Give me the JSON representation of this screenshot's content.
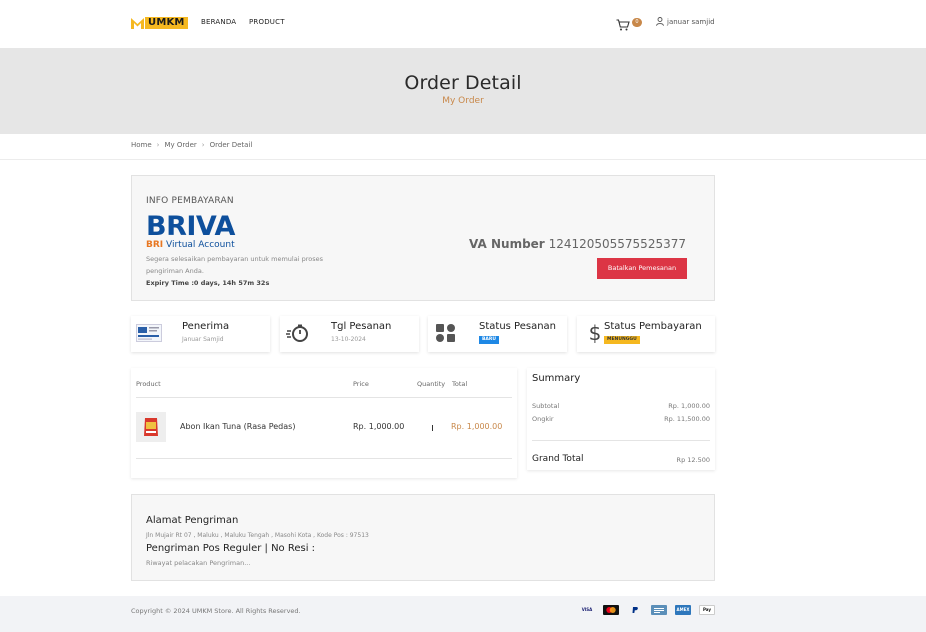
{
  "nav": {
    "logo_text": "UMKM",
    "links": [
      "BERANDA",
      "PRODUCT"
    ],
    "cart_count": "0",
    "user_name": "januar samjid",
    "colors": {
      "accent": "#c8884a",
      "logo_yellow": "#f5b820"
    }
  },
  "hero": {
    "title": "Order Detail",
    "subtitle": "My Order"
  },
  "breadcrumb": [
    "Home",
    "My Order",
    "Order Detail"
  ],
  "payment": {
    "title": "INFO PEMBAYARAN",
    "brand_big": "BRIVA",
    "brand_bri": "BRI",
    "brand_va": "Virtual Account",
    "hint": "Segera selesaikan pembayaran untuk memulai proses pengiriman Anda.",
    "expiry": "Expiry Time :0 days, 14h 57m 32s",
    "va_label": "VA Number",
    "va_value": "124120505575525377",
    "cancel_label": "Batalkan Pemesanan"
  },
  "info_cards": {
    "recipient": {
      "label": "Penerima",
      "value": "Januar Samjid"
    },
    "order_date": {
      "label": "Tgl Pesanan",
      "value": "13-10-2024"
    },
    "order_status": {
      "label": "Status Pesanan",
      "badge": "BARU",
      "badge_color": "#1e88e5"
    },
    "payment_status": {
      "label": "Status Pembayaran",
      "badge": "MENUNGGU",
      "badge_color": "#f5b820"
    }
  },
  "products": {
    "headers": {
      "product": "Product",
      "price": "Price",
      "quantity": "Quantity",
      "total": "Total"
    },
    "rows": [
      {
        "name": "Abon Ikan Tuna (Rasa Pedas)",
        "price": "Rp. 1,000.00",
        "quantity": "1",
        "total": "Rp. 1,000.00"
      }
    ]
  },
  "summary": {
    "title": "Summary",
    "subtotal_label": "Subtotal",
    "subtotal_value": "Rp. 1,000.00",
    "ongkir_label": "Ongkir",
    "ongkir_value": "Rp. 11,500.00",
    "grand_total_label": "Grand Total",
    "grand_total_value": "Rp 12.500"
  },
  "shipping": {
    "title": "Alamat Pengriman",
    "address": "Jln Mujair Rt 07 , Maluku , Maluku Tengah , Masohi Kota , Kode Pos : 97513",
    "service": "Pengriman Pos Reguler | No Resi :",
    "tracking": "Riwayat pelacakan Pengriman..."
  },
  "footer": {
    "copyright": "Copyright © 2024 UMKM Store. All Rights Reserved.",
    "payment_icons": [
      "visa-icon",
      "mastercard-icon",
      "paypal-icon",
      "bank-card-icon",
      "amex-icon",
      "apple-pay-icon"
    ],
    "payment_texts": {
      "visa": "VISA",
      "amex": "AMEX",
      "applepay": "Pay"
    }
  }
}
